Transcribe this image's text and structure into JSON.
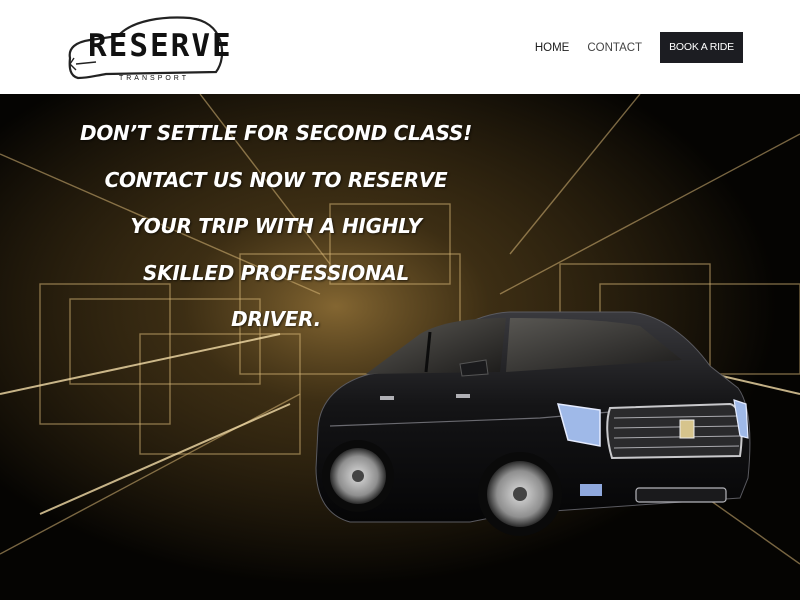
{
  "header": {
    "logo": {
      "word": "RESERVE",
      "sub": "TRANSPORT"
    },
    "nav": {
      "home_label": "HOME",
      "contact_label": "CONTACT",
      "book_label": "BOOK A RIDE"
    }
  },
  "hero": {
    "headline_lines": [
      "DON’T SETTLE FOR SECOND CLASS!",
      "CONTACT US NOW TO RESERVE",
      "YOUR TRIP WITH A HIGHLY",
      "SKILLED PROFESSIONAL",
      "DRIVER."
    ]
  },
  "colors": {
    "header_bg": "#ffffff",
    "button_bg": "#1c1d22",
    "hero_bg": "#050402",
    "hero_glow": "#c9a35a"
  }
}
